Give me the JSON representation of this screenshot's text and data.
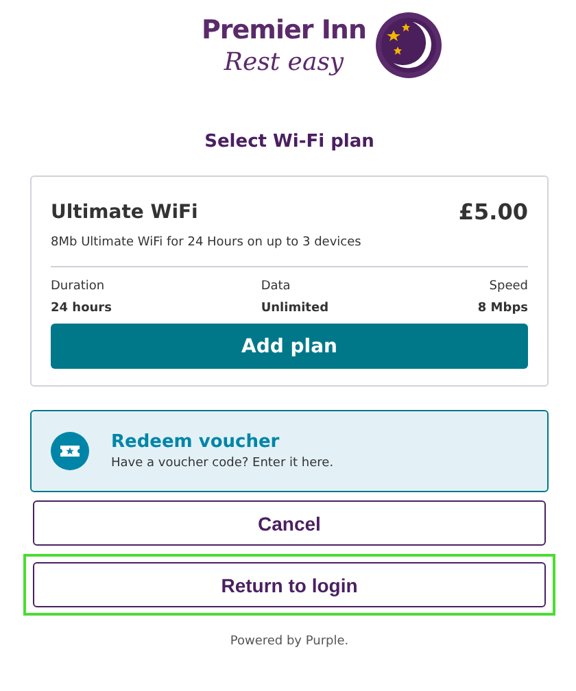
{
  "logo": {
    "brand": "Premier Inn",
    "tagline": "Rest easy"
  },
  "title": "Select Wi-Fi plan",
  "plan": {
    "name": "Ultimate WiFi",
    "price": "£5.00",
    "description": "8Mb Ultimate WiFi for 24 Hours on up to 3 devices",
    "specs": [
      {
        "label": "Duration",
        "value": "24 hours"
      },
      {
        "label": "Data",
        "value": "Unlimited"
      },
      {
        "label": "Speed",
        "value": "8 Mbps"
      }
    ],
    "button": "Add plan"
  },
  "voucher": {
    "title": "Redeem voucher",
    "text": "Have a voucher code? Enter it here."
  },
  "buttons": [
    {
      "label": "Cancel",
      "focused": false
    },
    {
      "label": "Return to login",
      "focused": true
    }
  ],
  "footer": "Powered by Purple."
}
